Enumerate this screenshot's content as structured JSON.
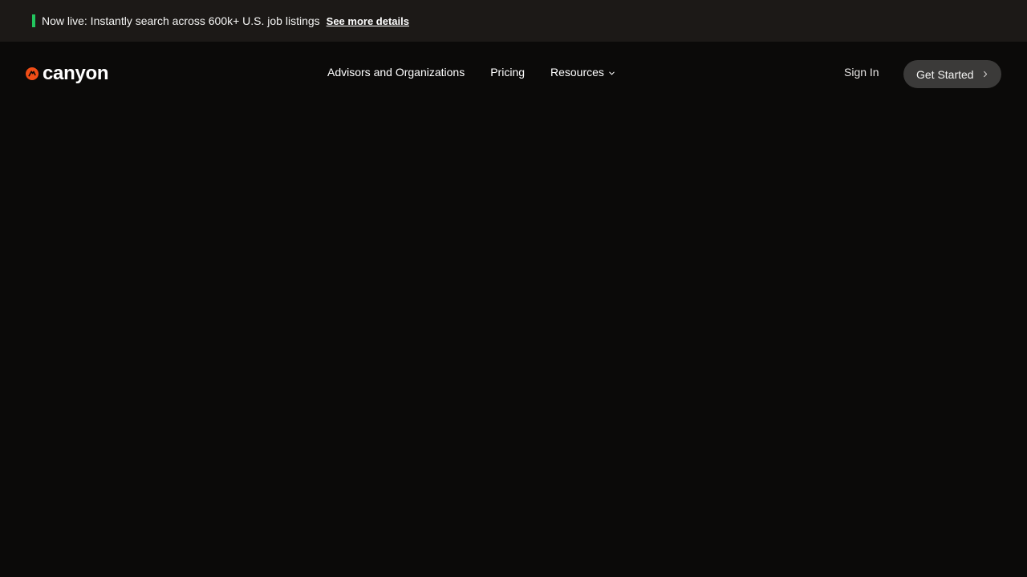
{
  "announcement": {
    "message": "Now live: Instantly search across 600k+ U.S. job listings",
    "link_label": "See more details",
    "indicator_color": "#22c55e"
  },
  "header": {
    "logo_text": "canyon",
    "logo_icon": "canyon-logo-icon",
    "brand_color": "#f04d16",
    "nav": {
      "advisors_label": "Advisors and Organizations",
      "pricing_label": "Pricing",
      "resources_label": "Resources"
    },
    "sign_in_label": "Sign In",
    "cta_label": "Get Started"
  },
  "colors": {
    "background": "#0b0a09",
    "announcement_bg": "#1c1917",
    "cta_bg": "#3b3a39"
  }
}
